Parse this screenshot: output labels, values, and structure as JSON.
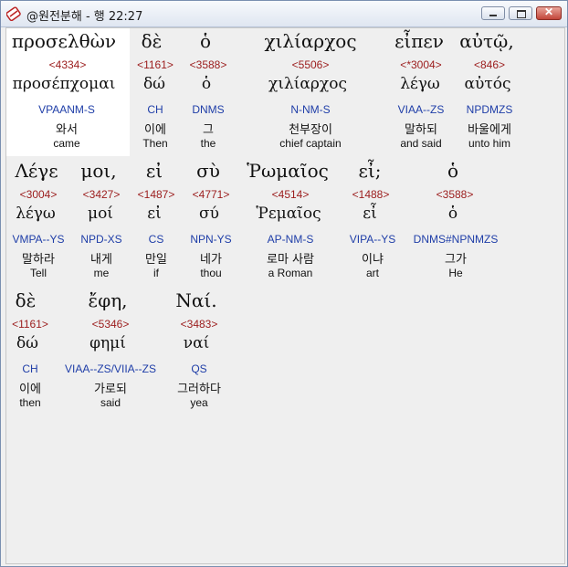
{
  "window": {
    "title": "@원전분해 - 행 22:27"
  },
  "rows": [
    {
      "words": [
        {
          "greek": "προσελθὼν",
          "num": "<4334>",
          "lemma": "προσέπχομαι",
          "parse": "VPAANM-S",
          "kor": "와서",
          "eng": "came"
        },
        {
          "greek": "δὲ",
          "num": "<1161>",
          "lemma": "δώ",
          "parse": "CH",
          "kor": "이에",
          "eng": "Then"
        },
        {
          "greek": "ὁ",
          "num": "<3588>",
          "lemma": "ὁ",
          "parse": "DNMS",
          "kor": "그",
          "eng": "the"
        },
        {
          "greek": "χιλίαρχος",
          "num": "<5506>",
          "lemma": "χιλίαρχος",
          "parse": "N-NM-S",
          "kor": "천부장이",
          "eng": "chief captain"
        },
        {
          "greek": "εἶπεν",
          "num": "<*3004>",
          "lemma": "λέγω",
          "parse": "VIAA--ZS",
          "kor": "말하되",
          "eng": "and said"
        },
        {
          "greek": "αὐτῷ,",
          "num": "<846>",
          "lemma": "αὐτός",
          "parse": "NPDMZS",
          "kor": "바울에게",
          "eng": "unto him"
        }
      ]
    },
    {
      "words": [
        {
          "greek": "Λέγε",
          "num": "<3004>",
          "lemma": "λέγω",
          "parse": "VMPA--YS",
          "kor": "말하라",
          "eng": "Tell"
        },
        {
          "greek": "μοι,",
          "num": "<3427>",
          "lemma": "μοί",
          "parse": "NPD-XS",
          "kor": "내게",
          "eng": "me"
        },
        {
          "greek": "εἰ",
          "num": "<1487>",
          "lemma": "εἰ",
          "parse": "CS",
          "kor": "만일",
          "eng": "if"
        },
        {
          "greek": "σὺ",
          "num": "<4771>",
          "lemma": "σύ",
          "parse": "NPN-YS",
          "kor": "네가",
          "eng": "thou"
        },
        {
          "greek": "Ῥωμαῖος",
          "num": "<4514>",
          "lemma": "Ῥεμαῖος",
          "parse": "AP-NM-S",
          "kor": "로마 사람",
          "eng": "a Roman"
        },
        {
          "greek": "εἶ;",
          "num": "<1488>",
          "lemma": "εἶ",
          "parse": "VIPA--YS",
          "kor": "이냐",
          "eng": "art"
        },
        {
          "greek": "ὁ",
          "num": "<3588>",
          "lemma": "ὁ",
          "parse": "DNMS#NPNMZS",
          "kor": "그가",
          "eng": "He"
        }
      ]
    },
    {
      "words": [
        {
          "greek": "δὲ",
          "num": "<1161>",
          "lemma": "δώ",
          "parse": "CH",
          "kor": "이에",
          "eng": "then"
        },
        {
          "greek": "ἔφη,",
          "num": "<5346>",
          "lemma": "φημί",
          "parse": "VIAA--ZS/VIIA--ZS",
          "kor": "가로되",
          "eng": "said"
        },
        {
          "greek": "Ναί.",
          "num": "<3483>",
          "lemma": "ναί",
          "parse": "QS",
          "kor": "그러하다",
          "eng": "yea"
        }
      ]
    }
  ]
}
